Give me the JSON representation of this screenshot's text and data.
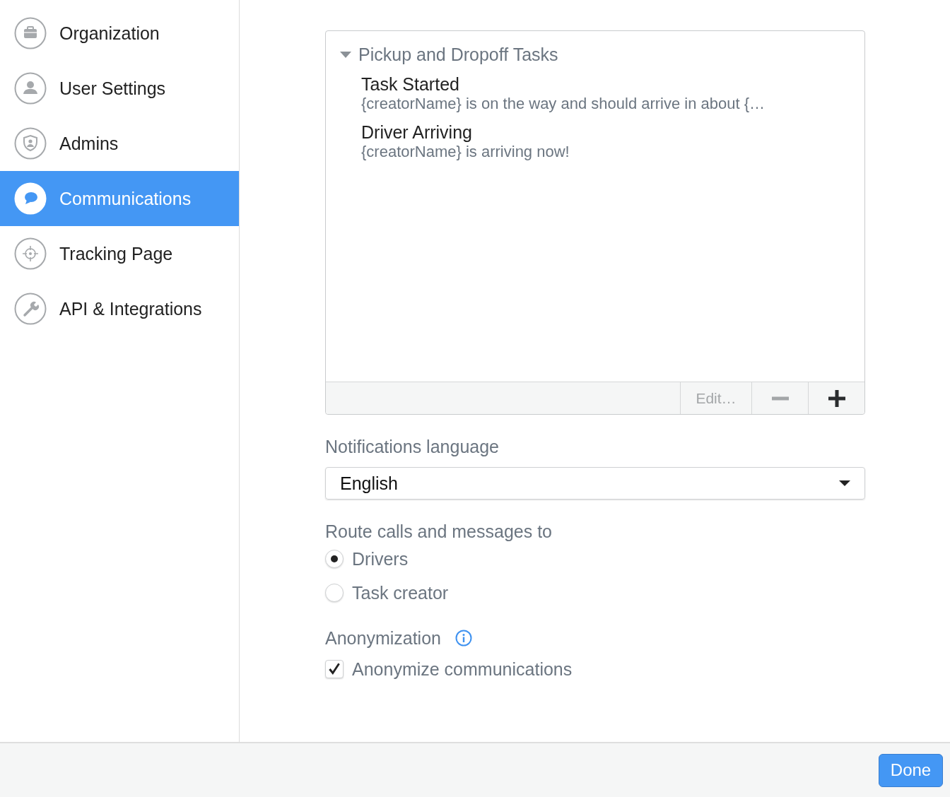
{
  "sidebar": {
    "items": [
      {
        "kind": "briefcase",
        "label": "Organization",
        "selected": false
      },
      {
        "kind": "user",
        "label": "User Settings",
        "selected": false
      },
      {
        "kind": "shield",
        "label": "Admins",
        "selected": false
      },
      {
        "kind": "chat",
        "label": "Communications",
        "selected": true
      },
      {
        "kind": "target",
        "label": "Tracking Page",
        "selected": false
      },
      {
        "kind": "wrench",
        "label": "API & Integrations",
        "selected": false
      }
    ]
  },
  "templates": {
    "group": {
      "title": "Pickup and Dropoff Tasks",
      "expanded": true,
      "items": [
        {
          "title": "Task Started",
          "text": "{creatorName} is on the way and should arrive in about {…"
        },
        {
          "title": "Driver Arriving",
          "text": "{creatorName} is arriving now!"
        }
      ]
    },
    "toolbar": {
      "edit": {
        "label": "Edit…",
        "disabled": true
      },
      "remove": {
        "disabled": true
      },
      "add": {
        "disabled": false
      }
    }
  },
  "language": {
    "label": "Notifications language",
    "value": "English"
  },
  "routing": {
    "label": "Route calls and messages to",
    "options": [
      {
        "label": "Drivers",
        "selected": true
      },
      {
        "label": "Task creator",
        "selected": false
      }
    ]
  },
  "anonymization": {
    "label": "Anonymization",
    "option": {
      "label": "Anonymize communications",
      "checked": true
    }
  },
  "footer": {
    "done": "Done"
  }
}
